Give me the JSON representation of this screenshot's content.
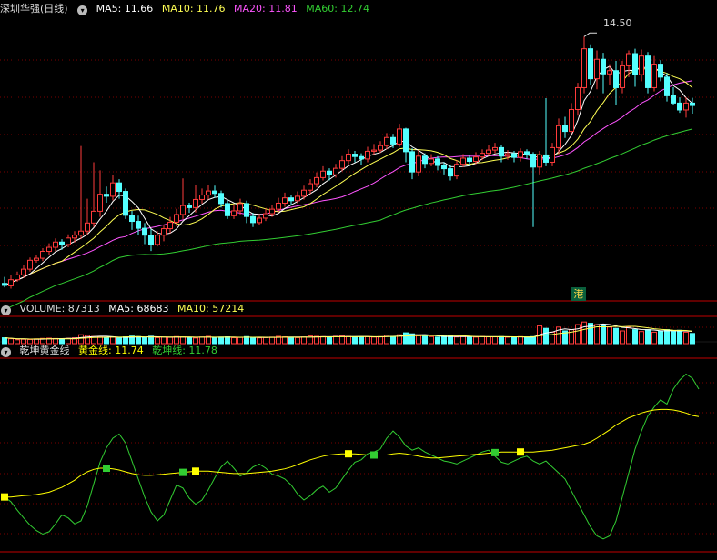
{
  "header_price": {
    "stock_name": "深圳华强(日线)",
    "ma5_label": "MA5: 11.66",
    "ma10_label": "MA10: 11.76",
    "ma20_label": "MA20: 11.81",
    "ma60_label": "MA60: 12.74"
  },
  "header_volume": {
    "volume_label": "VOLUME: 87313",
    "ma5_label": "MA5: 68683",
    "ma10_label": "MA10: 57214"
  },
  "header_indicator": {
    "title": "乾坤黄金线",
    "gold_label": "黄金线: 11.74",
    "qiankun_label": "乾坤线: 11.78"
  },
  "max_price_label": "14.50",
  "port_badge": "港",
  "colors": {
    "up": "#ff3b3b",
    "down": "#54ffff",
    "ma5": "#ffffff",
    "ma10": "#ffff54",
    "ma20": "#ff55ff",
    "ma60": "#32cd32",
    "gold": "#ffff00",
    "qiankun": "#32cd32",
    "grid": "#7a0000"
  },
  "chart_data": {
    "type": "candlestick",
    "price_yrange": [
      8.0,
      15.0
    ],
    "volume_yrange": [
      0,
      250000
    ],
    "candles": [
      [
        8.41,
        8.36,
        8.57,
        8.31
      ],
      [
        8.35,
        8.5,
        8.62,
        8.28
      ],
      [
        8.5,
        8.62,
        8.7,
        8.45
      ],
      [
        8.62,
        8.76,
        8.86,
        8.55
      ],
      [
        8.76,
        8.98,
        9.05,
        8.7
      ],
      [
        8.98,
        9.03,
        9.11,
        8.92
      ],
      [
        9.03,
        9.2,
        9.28,
        8.96
      ],
      [
        9.2,
        9.3,
        9.4,
        9.1
      ],
      [
        9.3,
        9.43,
        9.52,
        9.2
      ],
      [
        9.43,
        9.37,
        9.5,
        9.24
      ],
      [
        9.37,
        9.53,
        9.62,
        9.3
      ],
      [
        9.53,
        9.6,
        9.7,
        9.42
      ],
      [
        9.6,
        9.7,
        11.8,
        9.5
      ],
      [
        9.7,
        9.9,
        10.5,
        9.6
      ],
      [
        9.9,
        10.19,
        11.4,
        9.8
      ],
      [
        10.19,
        10.61,
        11.2,
        10.05
      ],
      [
        10.61,
        10.56,
        10.8,
        10.4
      ],
      [
        10.56,
        10.89,
        11.08,
        10.46
      ],
      [
        10.89,
        10.68,
        10.98,
        10.5
      ],
      [
        10.68,
        10.09,
        10.75,
        10.0
      ],
      [
        10.09,
        9.94,
        10.2,
        9.73
      ],
      [
        9.94,
        9.77,
        10.08,
        9.6
      ],
      [
        9.77,
        9.6,
        9.9,
        9.38
      ],
      [
        9.6,
        9.37,
        9.75,
        9.21
      ],
      [
        9.37,
        9.6,
        9.7,
        9.32
      ],
      [
        9.6,
        9.76,
        9.85,
        9.45
      ],
      [
        9.76,
        9.92,
        10.05,
        9.65
      ],
      [
        9.92,
        10.11,
        10.25,
        9.82
      ],
      [
        10.11,
        10.33,
        11.0,
        10.0
      ],
      [
        10.33,
        10.28,
        10.4,
        10.15
      ],
      [
        10.28,
        10.48,
        10.85,
        10.16
      ],
      [
        10.48,
        10.59,
        10.75,
        10.38
      ],
      [
        10.59,
        10.69,
        10.85,
        10.48
      ],
      [
        10.69,
        10.63,
        10.82,
        10.52
      ],
      [
        10.63,
        10.38,
        10.7,
        10.28
      ],
      [
        10.38,
        10.08,
        10.45,
        10.0
      ],
      [
        10.08,
        10.2,
        10.35,
        10.0
      ],
      [
        10.2,
        10.38,
        10.5,
        10.1
      ],
      [
        10.38,
        10.06,
        10.45,
        9.9
      ],
      [
        10.06,
        9.91,
        10.15,
        9.8
      ],
      [
        9.91,
        10.02,
        10.12,
        9.85
      ],
      [
        10.02,
        10.13,
        10.25,
        9.95
      ],
      [
        10.13,
        10.24,
        10.35,
        10.05
      ],
      [
        10.24,
        10.39,
        10.52,
        10.16
      ],
      [
        10.39,
        10.52,
        10.65,
        10.3
      ],
      [
        10.52,
        10.45,
        10.6,
        10.35
      ],
      [
        10.45,
        10.56,
        10.68,
        10.38
      ],
      [
        10.56,
        10.71,
        10.82,
        10.48
      ],
      [
        10.71,
        10.87,
        10.98,
        10.62
      ],
      [
        10.87,
        11.02,
        11.15,
        10.78
      ],
      [
        11.02,
        11.18,
        11.3,
        10.95
      ],
      [
        11.18,
        11.09,
        11.25,
        10.95
      ],
      [
        11.09,
        11.25,
        11.36,
        11.02
      ],
      [
        11.25,
        11.44,
        11.55,
        11.18
      ],
      [
        11.44,
        11.6,
        11.72,
        11.35
      ],
      [
        11.6,
        11.54,
        11.68,
        11.4
      ],
      [
        11.54,
        11.48,
        11.62,
        11.34
      ],
      [
        11.48,
        11.67,
        11.78,
        11.4
      ],
      [
        11.67,
        11.7,
        11.85,
        11.58
      ],
      [
        11.7,
        11.81,
        11.92,
        11.63
      ],
      [
        11.81,
        12.01,
        12.12,
        11.72
      ],
      [
        12.01,
        11.85,
        12.1,
        11.75
      ],
      [
        11.85,
        12.22,
        12.35,
        11.78
      ],
      [
        12.22,
        11.66,
        12.25,
        11.4
      ],
      [
        11.66,
        11.16,
        11.75,
        10.98
      ],
      [
        11.16,
        11.55,
        11.7,
        11.05
      ],
      [
        11.55,
        11.37,
        11.62,
        11.25
      ],
      [
        11.37,
        11.48,
        11.6,
        11.3
      ],
      [
        11.48,
        11.32,
        11.55,
        11.2
      ],
      [
        11.32,
        11.24,
        11.4,
        11.1
      ],
      [
        11.24,
        11.06,
        11.32,
        10.95
      ],
      [
        11.06,
        11.35,
        11.45,
        10.98
      ],
      [
        11.35,
        11.5,
        11.6,
        11.28
      ],
      [
        11.5,
        11.42,
        11.58,
        11.3
      ],
      [
        11.42,
        11.53,
        11.65,
        11.35
      ],
      [
        11.53,
        11.62,
        11.72,
        11.45
      ],
      [
        11.62,
        11.7,
        11.82,
        11.55
      ],
      [
        11.7,
        11.76,
        11.88,
        11.62
      ],
      [
        11.76,
        11.55,
        11.82,
        11.4
      ],
      [
        11.55,
        11.61,
        11.7,
        11.46
      ],
      [
        11.61,
        11.52,
        11.68,
        11.4
      ],
      [
        11.52,
        11.66,
        11.74,
        11.42
      ],
      [
        11.66,
        11.6,
        11.72,
        11.48
      ],
      [
        11.6,
        11.28,
        11.65,
        9.8
      ],
      [
        11.28,
        11.58,
        11.68,
        11.1
      ],
      [
        11.58,
        11.4,
        12.98,
        11.3
      ],
      [
        11.4,
        11.76,
        11.88,
        11.3
      ],
      [
        11.76,
        12.3,
        12.48,
        11.6
      ],
      [
        12.3,
        12.16,
        12.52,
        12.0
      ],
      [
        12.16,
        12.7,
        12.86,
        12.1
      ],
      [
        12.7,
        13.24,
        13.36,
        12.55
      ],
      [
        13.24,
        14.2,
        14.5,
        13.1
      ],
      [
        14.2,
        13.46,
        14.31,
        13.3
      ],
      [
        13.46,
        13.94,
        14.16,
        13.2
      ],
      [
        13.94,
        13.58,
        14.1,
        13.1
      ],
      [
        13.58,
        13.66,
        13.82,
        13.3
      ],
      [
        13.66,
        13.24,
        13.9,
        12.8
      ],
      [
        13.24,
        13.78,
        13.9,
        13.1
      ],
      [
        13.78,
        14.08,
        14.16,
        13.5
      ],
      [
        14.08,
        13.56,
        14.2,
        13.26
      ],
      [
        13.56,
        14.02,
        14.18,
        13.4
      ],
      [
        14.02,
        13.24,
        14.12,
        13.1
      ],
      [
        13.24,
        13.82,
        14.02,
        13.15
      ],
      [
        13.82,
        13.5,
        13.92,
        13.4
      ],
      [
        13.5,
        13.04,
        13.6,
        12.9
      ],
      [
        13.04,
        12.86,
        13.25,
        12.8
      ],
      [
        12.86,
        12.69,
        13.0,
        12.62
      ],
      [
        12.69,
        12.86,
        13.0,
        12.5
      ],
      [
        12.86,
        12.8,
        12.99,
        12.6
      ]
    ],
    "volume": [
      46,
      38,
      30,
      34,
      32,
      37,
      41,
      43,
      40,
      37,
      42,
      46,
      70,
      64,
      56,
      52,
      47,
      51,
      44,
      53,
      59,
      55,
      49,
      58,
      47,
      51,
      49,
      55,
      52,
      49,
      44,
      52,
      57,
      48,
      51,
      53,
      46,
      49,
      55,
      48,
      45,
      47,
      51,
      57,
      53,
      49,
      47,
      52,
      60,
      57,
      55,
      47,
      58,
      62,
      57,
      51,
      53,
      55,
      51,
      55,
      66,
      57,
      70,
      85,
      77,
      62,
      58,
      55,
      51,
      57,
      59,
      52,
      55,
      57,
      51,
      56,
      53,
      53,
      55,
      50,
      52,
      55,
      47,
      55,
      140,
      120,
      90,
      130,
      100,
      110,
      150,
      170,
      160,
      150,
      140,
      130,
      120,
      100,
      130,
      110,
      95,
      110,
      90,
      100,
      110,
      95,
      105,
      90,
      80
    ],
    "gold_line": [
      10.4,
      10.4,
      10.41,
      10.42,
      10.43,
      10.44,
      10.46,
      10.48,
      10.52,
      10.56,
      10.62,
      10.68,
      10.76,
      10.82,
      10.86,
      10.88,
      10.88,
      10.87,
      10.85,
      10.82,
      10.79,
      10.77,
      10.76,
      10.76,
      10.77,
      10.78,
      10.79,
      10.8,
      10.81,
      10.82,
      10.83,
      10.83,
      10.83,
      10.82,
      10.81,
      10.8,
      10.79,
      10.79,
      10.79,
      10.8,
      10.81,
      10.82,
      10.83,
      10.85,
      10.87,
      10.9,
      10.94,
      10.98,
      11.02,
      11.05,
      11.08,
      11.1,
      11.11,
      11.12,
      11.12,
      11.12,
      11.11,
      11.1,
      11.1,
      11.1,
      11.1,
      11.12,
      11.13,
      11.12,
      11.1,
      11.08,
      11.06,
      11.05,
      11.05,
      11.06,
      11.07,
      11.08,
      11.09,
      11.1,
      11.11,
      11.12,
      11.13,
      11.14,
      11.15,
      11.15,
      11.15,
      11.15,
      11.15,
      11.15,
      11.16,
      11.17,
      11.18,
      11.2,
      11.22,
      11.24,
      11.26,
      11.28,
      11.32,
      11.38,
      11.45,
      11.52,
      11.6,
      11.66,
      11.72,
      11.76,
      11.8,
      11.83,
      11.85,
      11.86,
      11.86,
      11.85,
      11.83,
      11.8,
      11.76,
      11.74
    ],
    "qiankun_line": [
      10.4,
      10.32,
      10.18,
      10.05,
      9.93,
      9.84,
      9.78,
      9.82,
      9.95,
      10.1,
      10.05,
      9.95,
      10.0,
      10.25,
      10.62,
      10.98,
      11.22,
      11.38,
      11.45,
      11.3,
      11.0,
      10.7,
      10.4,
      10.15,
      10.0,
      10.1,
      10.35,
      10.6,
      10.55,
      10.38,
      10.28,
      10.35,
      10.52,
      10.72,
      10.9,
      11.0,
      10.88,
      10.75,
      10.8,
      10.9,
      10.95,
      10.88,
      10.78,
      10.75,
      10.7,
      10.6,
      10.45,
      10.35,
      10.42,
      10.52,
      10.58,
      10.48,
      10.55,
      10.7,
      10.85,
      10.98,
      11.02,
      11.12,
      11.15,
      11.2,
      11.38,
      11.5,
      11.4,
      11.25,
      11.18,
      11.22,
      11.15,
      11.1,
      11.05,
      11.0,
      10.98,
      10.95,
      11.0,
      11.05,
      11.1,
      11.15,
      11.18,
      11.08,
      10.98,
      10.95,
      11.0,
      11.05,
      11.08,
      11.0,
      10.95,
      11.0,
      10.9,
      10.8,
      10.7,
      10.5,
      10.3,
      10.1,
      9.9,
      9.75,
      9.7,
      9.75,
      10.0,
      10.4,
      10.8,
      11.2,
      11.5,
      11.75,
      11.9,
      12.02,
      11.95,
      12.2,
      12.35,
      12.45,
      12.38,
      12.2
    ],
    "gold_markers": [
      0,
      30,
      54,
      81
    ],
    "qiankun_markers": [
      16,
      28,
      58,
      77
    ]
  }
}
